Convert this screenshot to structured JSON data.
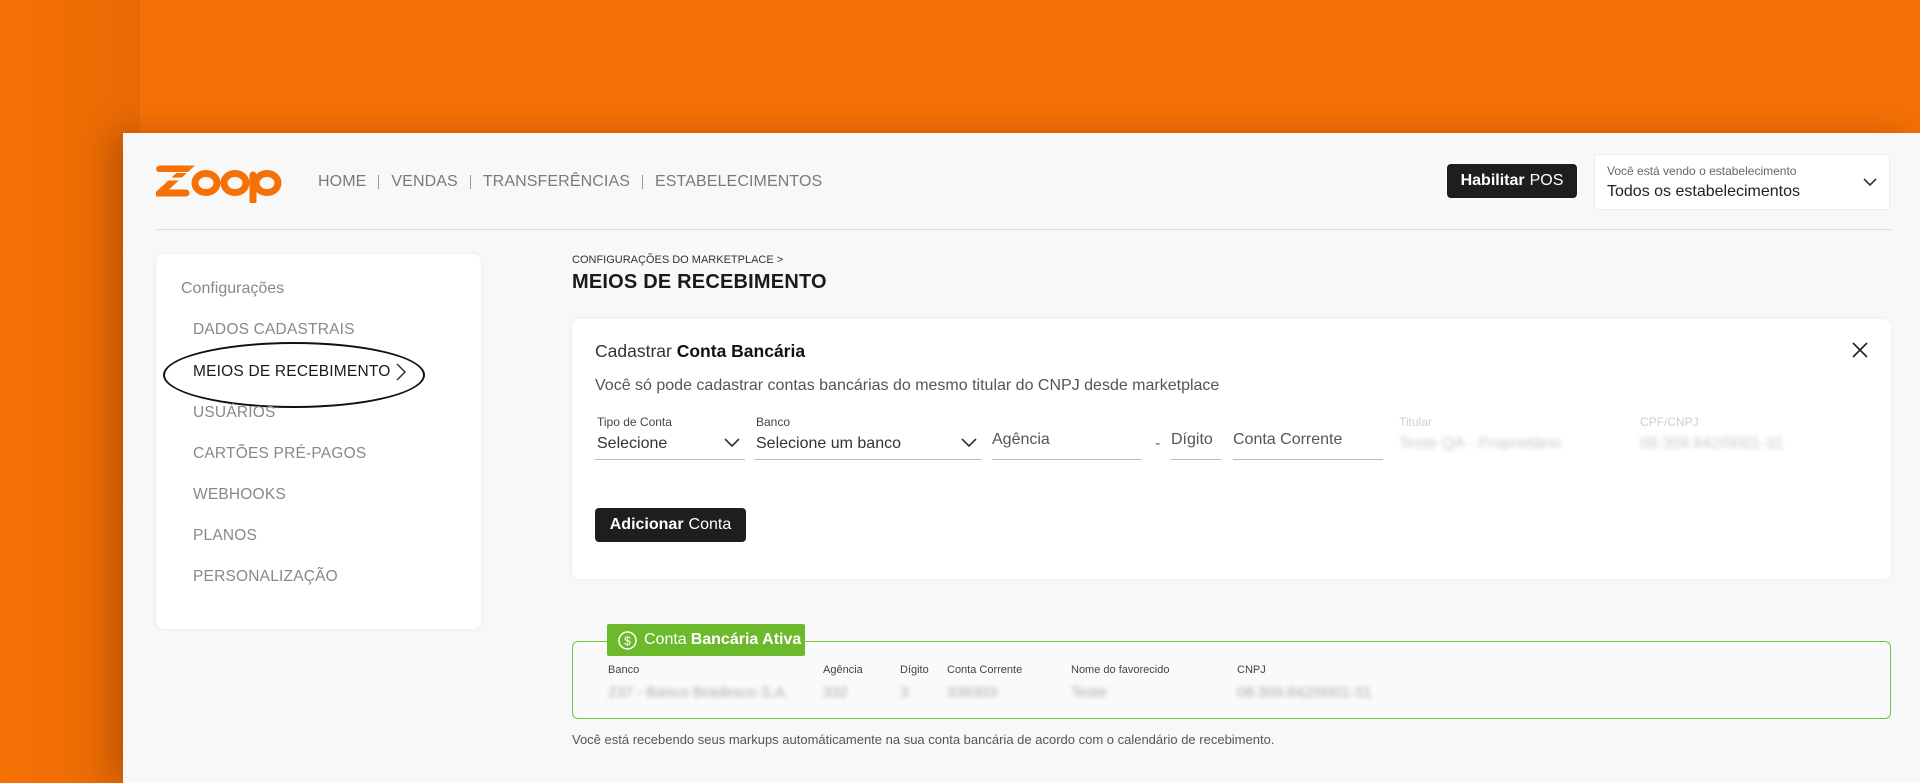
{
  "brand": {
    "logo": "zoop",
    "accent": "#f57105"
  },
  "nav": [
    {
      "label": "HOME"
    },
    {
      "label": "VENDAS"
    },
    {
      "label": "TRANSFERÊNCIAS"
    },
    {
      "label": "ESTABELECIMENTOS"
    }
  ],
  "header": {
    "pos_button": {
      "bold": "Habilitar",
      "rest": "POS"
    },
    "establishment": {
      "caption": "Você está vendo o estabelecimento",
      "value": "Todos os estabelecimentos",
      "icon": "chevron-down-icon"
    }
  },
  "sidebar": {
    "title": "Configurações",
    "items": [
      {
        "label": "DADOS CADASTRAIS"
      },
      {
        "label": "MEIOS DE RECEBIMENTO"
      },
      {
        "label": "USUÁRIOS"
      },
      {
        "label": "CARTÕES PRÉ-PAGOS"
      },
      {
        "label": "WEBHOOKS"
      },
      {
        "label": "PLANOS"
      },
      {
        "label": "PERSONALIZAÇÃO"
      }
    ]
  },
  "breadcrumb": "CONFIGURAÇÕES DO MARKETPLACE >",
  "page_title": "MEIOS DE RECEBIMENTO",
  "form": {
    "title_prefix": "Cadastrar",
    "title_bold": "Conta Bancária",
    "subtitle": "Você só pode cadastrar contas bancárias do mesmo titular do CNPJ desde marketplace",
    "tipo_label": "Tipo de Conta",
    "tipo_value": "Selecione",
    "banco_label": "Banco",
    "banco_value": "Selecione um banco",
    "agencia_ph": "Agência",
    "dash": "-",
    "digito_ph": "Dígito",
    "conta_ph": "Conta Corrente",
    "titular_label": "Titular",
    "titular_value": "Teste QA - Proprietário",
    "cpf_label": "CPF/CNPJ",
    "cpf_value": "08.309.842/0001-31",
    "add_bold": "Adicionar",
    "add_rest": "Conta"
  },
  "active_account": {
    "tag_prefix": "Conta",
    "tag_bold": "Bancária Ativa",
    "icon": "dollar-circle-icon",
    "columns": [
      {
        "label": "Banco",
        "value": "237 - Banco Bradesco S.A."
      },
      {
        "label": "Agência",
        "value": "332"
      },
      {
        "label": "Dígito",
        "value": "3"
      },
      {
        "label": "Conta Corrente",
        "value": "339303"
      },
      {
        "label": "Nome do favorecido",
        "value": "Teste"
      },
      {
        "label": "CNPJ",
        "value": "08.309.842/0001-31"
      }
    ],
    "footnote": "Você está recebendo seus markups automáticamente na sua conta bancária de acordo com o calendário de recebimento."
  },
  "colors": {
    "dark_button": "#1e1e1e",
    "active_green": "#6cba2c",
    "active_border": "#7cc247"
  }
}
